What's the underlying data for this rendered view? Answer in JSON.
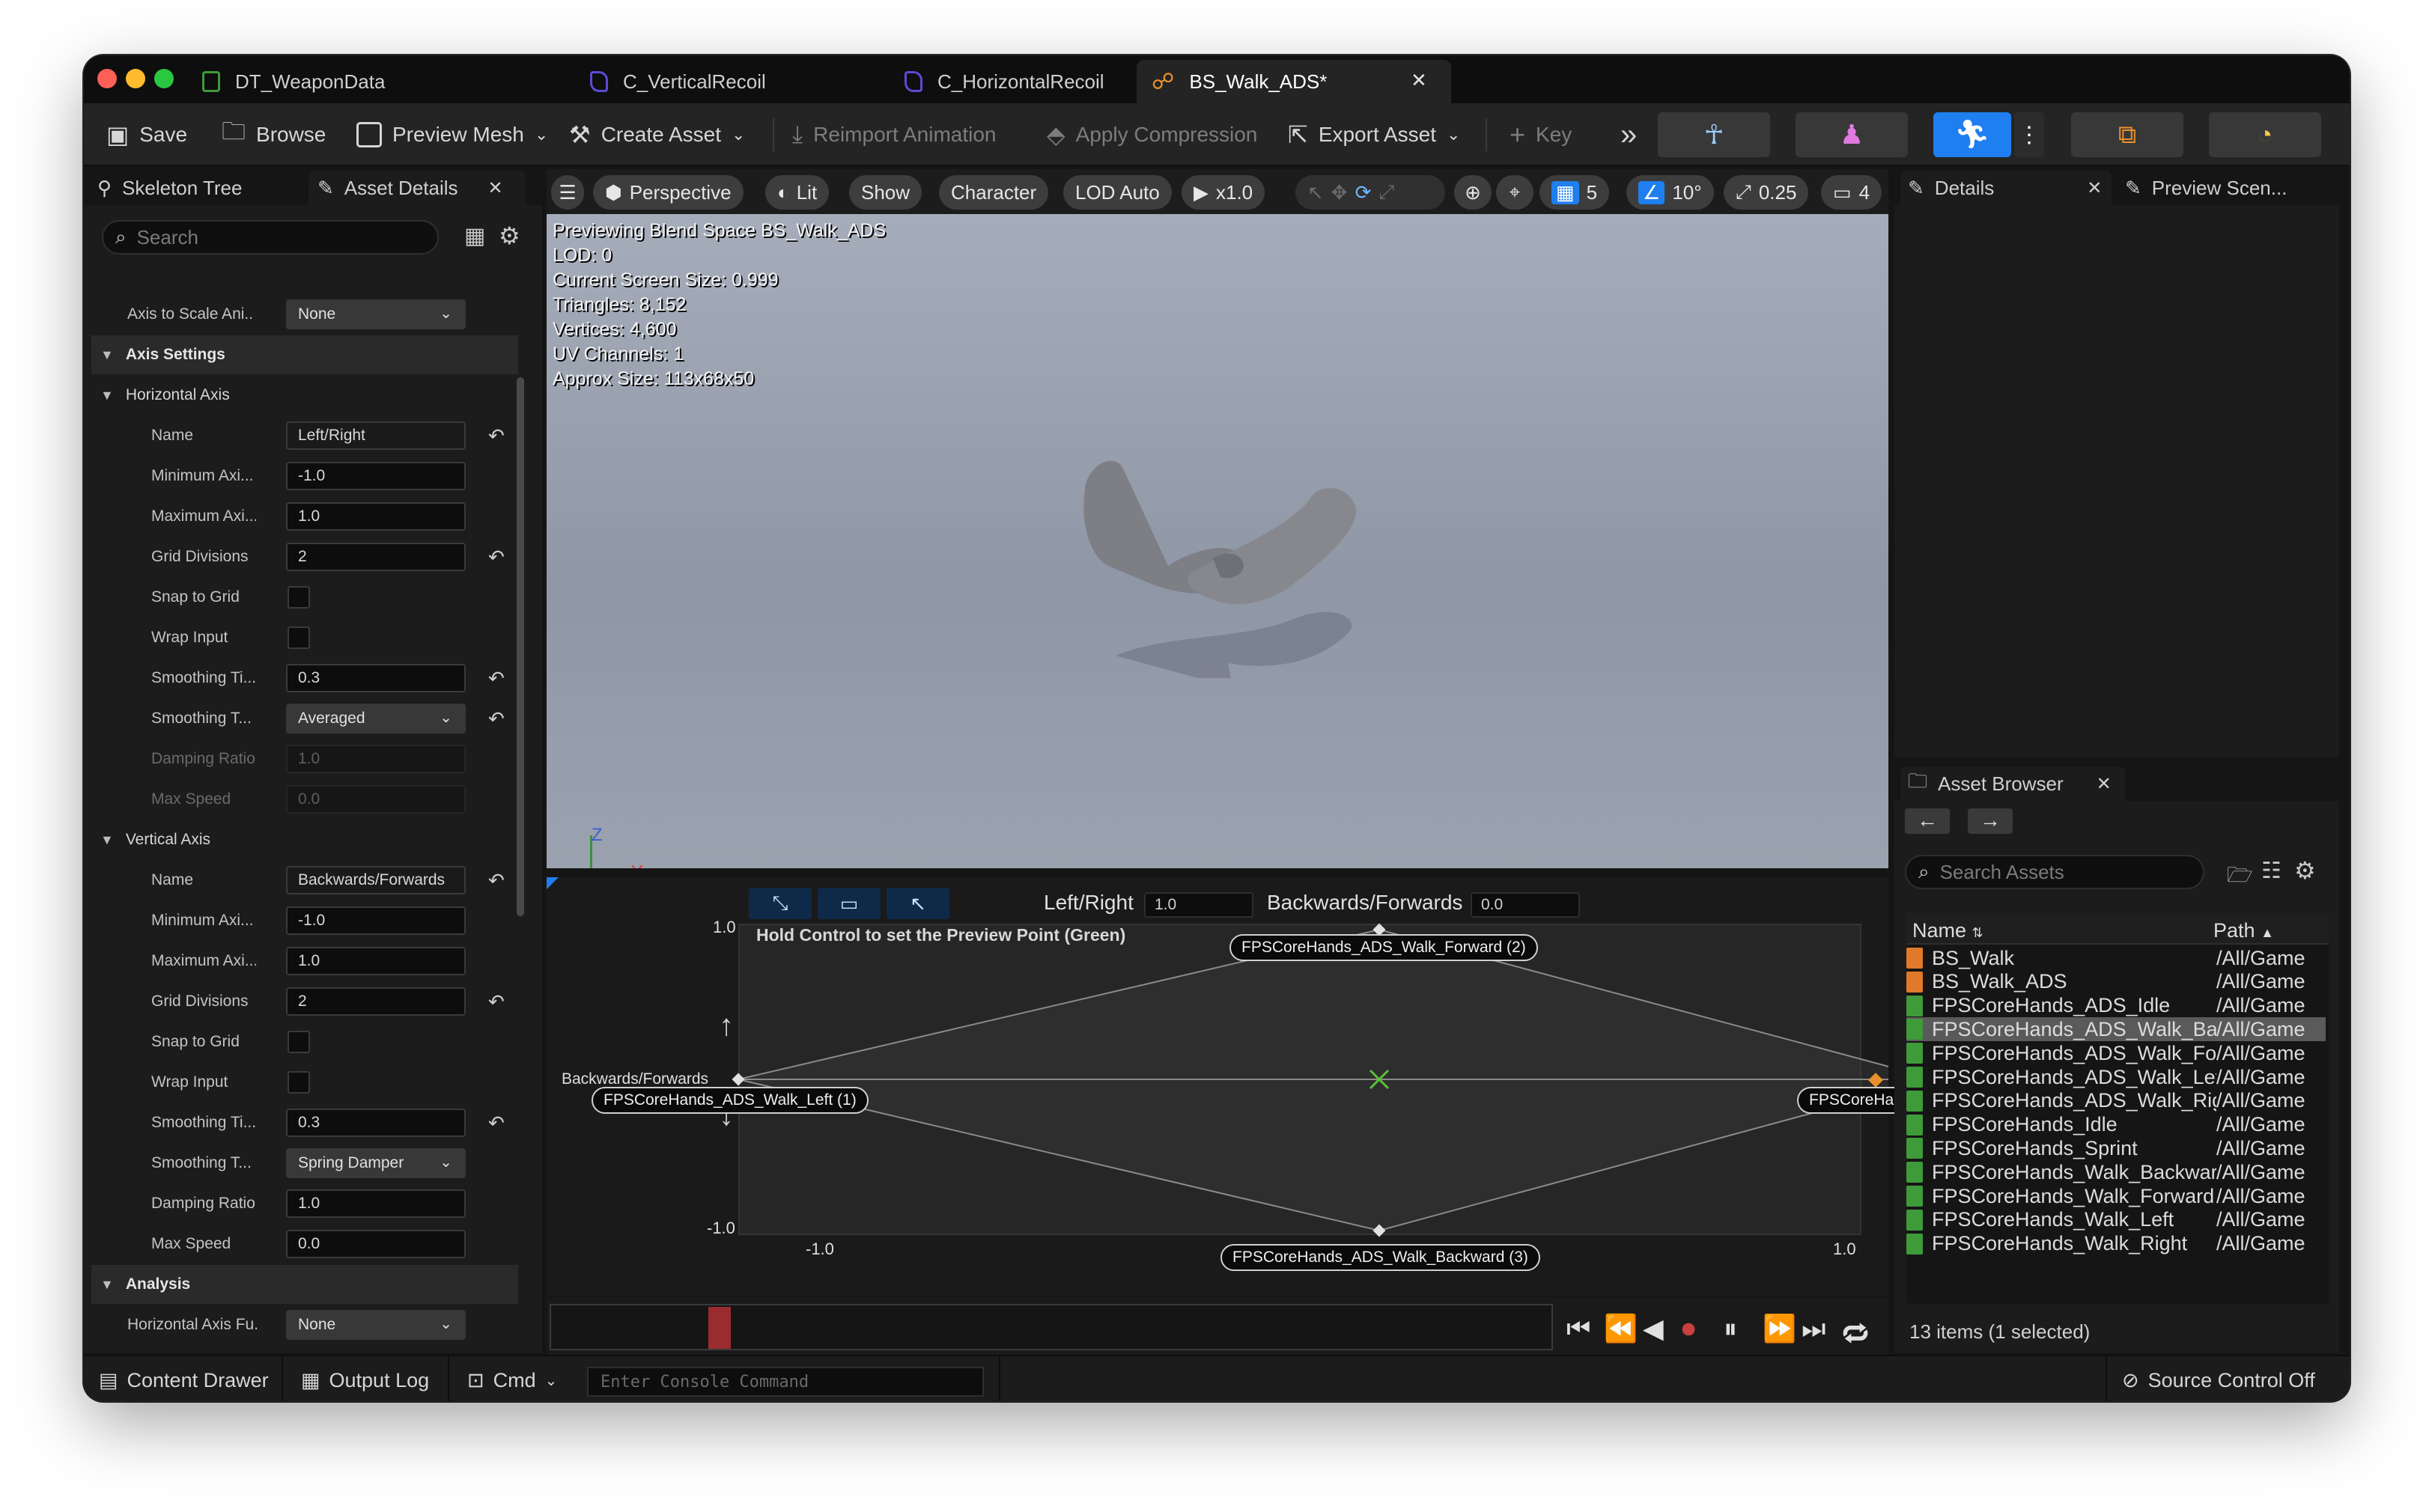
{
  "tabs": [
    {
      "label": "DT_WeaponData"
    },
    {
      "label": "C_VerticalRecoil"
    },
    {
      "label": "C_HorizontalRecoil"
    },
    {
      "label": "BS_Walk_ADS*"
    }
  ],
  "toolbar": {
    "save": "Save",
    "browse": "Browse",
    "preview_mesh": "Preview Mesh",
    "create_asset": "Create Asset",
    "reimport": "Reimport Animation",
    "apply_compression": "Apply Compression",
    "export_asset": "Export Asset",
    "key": "Key"
  },
  "left_panel": {
    "tabs": [
      "Skeleton Tree",
      "Asset Details"
    ],
    "search_placeholder": "Search",
    "axis_to_scale": {
      "label": "Axis to Scale Ani...",
      "value": "None"
    },
    "axis_settings": "Axis Settings",
    "horizontal_axis": {
      "title": "Horizontal Axis",
      "name": {
        "label": "Name",
        "value": "Left/Right"
      },
      "min": {
        "label": "Minimum Axi...",
        "value": "-1.0"
      },
      "max": {
        "label": "Maximum Axi...",
        "value": "1.0"
      },
      "grid": {
        "label": "Grid Divisions",
        "value": "2"
      },
      "snap": {
        "label": "Snap to Grid"
      },
      "wrap": {
        "label": "Wrap Input"
      },
      "smoothing_time": {
        "label": "Smoothing Ti...",
        "value": "0.3"
      },
      "smoothing_type": {
        "label": "Smoothing T...",
        "value": "Averaged"
      },
      "damping": {
        "label": "Damping Ratio",
        "value": "1.0"
      },
      "max_speed": {
        "label": "Max Speed",
        "value": "0.0"
      }
    },
    "vertical_axis": {
      "title": "Vertical Axis",
      "name": {
        "label": "Name",
        "value": "Backwards/Forwards"
      },
      "min": {
        "label": "Minimum Axi...",
        "value": "-1.0"
      },
      "max": {
        "label": "Maximum Axi...",
        "value": "1.0"
      },
      "grid": {
        "label": "Grid Divisions",
        "value": "2"
      },
      "snap": {
        "label": "Snap to Grid"
      },
      "wrap": {
        "label": "Wrap Input"
      },
      "smoothing_time": {
        "label": "Smoothing Ti...",
        "value": "0.3"
      },
      "smoothing_type": {
        "label": "Smoothing T...",
        "value": "Spring Damper"
      },
      "damping": {
        "label": "Damping Ratio",
        "value": "1.0"
      },
      "max_speed": {
        "label": "Max Speed",
        "value": "0.0"
      }
    },
    "analysis": "Analysis",
    "h_axis_func": {
      "label": "Horizontal Axis Fu...",
      "value": "None"
    }
  },
  "viewport": {
    "perspective": "Perspective",
    "lit": "Lit",
    "show": "Show",
    "character": "Character",
    "lod": "LOD Auto",
    "speed": "x1.0",
    "grid_snap": "5",
    "rot_snap": "10°",
    "scale_snap": "0.25",
    "camera_speed": "4",
    "stats": [
      "Previewing Blend Space BS_Walk_ADS",
      "LOD: 0",
      "Current Screen Size: 0.999",
      "Triangles: 8,152",
      "Vertices: 4,600",
      "UV Channels: 1",
      "Approx Size: 113x68x50"
    ],
    "axis_z": "Z",
    "axis_x": "X"
  },
  "blend_graph": {
    "h_label": "Left/Right",
    "h_value": "1.0",
    "v_label": "Backwards/Forwards",
    "v_value": "0.0",
    "hint": "Hold Control to set the Preview Point (Green)",
    "y_max": "1.0",
    "y_min": "-1.0",
    "x_min": "-1.0",
    "x_max": "1.0",
    "y_axis_label": "Backwards/Forwards",
    "samples": {
      "forward": "FPSCoreHands_ADS_Walk_Forward (2)",
      "left": "FPSCoreHands_ADS_Walk_Left (1)",
      "right": "FPSCoreHands_ADS_W",
      "backward": "FPSCoreHands_ADS_Walk_Backward (3)"
    }
  },
  "right_panel": {
    "details_tab": "Details",
    "preview_tab": "Preview Scen...",
    "asset_browser_tab": "Asset Browser",
    "search_placeholder": "Search Assets",
    "col_name": "Name",
    "col_path": "Path",
    "assets": [
      {
        "name": "BS_Walk",
        "path": "/All/Game",
        "icon": "blendspace-icon",
        "color": "#e07a2a"
      },
      {
        "name": "BS_Walk_ADS",
        "path": "/All/Game",
        "icon": "blendspace-icon",
        "color": "#e07a2a"
      },
      {
        "name": "FPSCoreHands_ADS_Idle",
        "path": "/All/Game",
        "icon": "anim-sequence-icon",
        "color": "#3f9a3a"
      },
      {
        "name": "FPSCoreHands_ADS_Walk_Bac",
        "path": "/All/Game",
        "icon": "anim-sequence-icon",
        "color": "#3f9a3a"
      },
      {
        "name": "FPSCoreHands_ADS_Walk_For",
        "path": "/All/Game",
        "icon": "anim-sequence-icon",
        "color": "#3f9a3a"
      },
      {
        "name": "FPSCoreHands_ADS_Walk_Left",
        "path": "/All/Game",
        "icon": "anim-sequence-icon",
        "color": "#3f9a3a"
      },
      {
        "name": "FPSCoreHands_ADS_Walk_Rig",
        "path": "/All/Game",
        "icon": "anim-sequence-icon",
        "color": "#3f9a3a"
      },
      {
        "name": "FPSCoreHands_Idle",
        "path": "/All/Game",
        "icon": "anim-sequence-icon",
        "color": "#3f9a3a"
      },
      {
        "name": "FPSCoreHands_Sprint",
        "path": "/All/Game",
        "icon": "anim-sequence-icon",
        "color": "#3f9a3a"
      },
      {
        "name": "FPSCoreHands_Walk_Backwar",
        "path": "/All/Game",
        "icon": "anim-sequence-icon",
        "color": "#3f9a3a"
      },
      {
        "name": "FPSCoreHands_Walk_Forward",
        "path": "/All/Game",
        "icon": "anim-sequence-icon",
        "color": "#3f9a3a"
      },
      {
        "name": "FPSCoreHands_Walk_Left",
        "path": "/All/Game",
        "icon": "anim-sequence-icon",
        "color": "#3f9a3a"
      },
      {
        "name": "FPSCoreHands_Walk_Right",
        "path": "/All/Game",
        "icon": "anim-sequence-icon",
        "color": "#3f9a3a"
      }
    ],
    "item_count": "13 items (1 selected)"
  },
  "statusbar": {
    "content_drawer": "Content Drawer",
    "output_log": "Output Log",
    "cmd": "Cmd",
    "console_placeholder": "Enter Console Command",
    "source_control": "Source Control Off"
  },
  "colors": {
    "accent_blue": "#1f7ff0",
    "selected_row": "#5a5a5a",
    "scrub_red": "#9a2c30",
    "preview_green": "#59c23a",
    "sample_orange": "#e8912c"
  }
}
